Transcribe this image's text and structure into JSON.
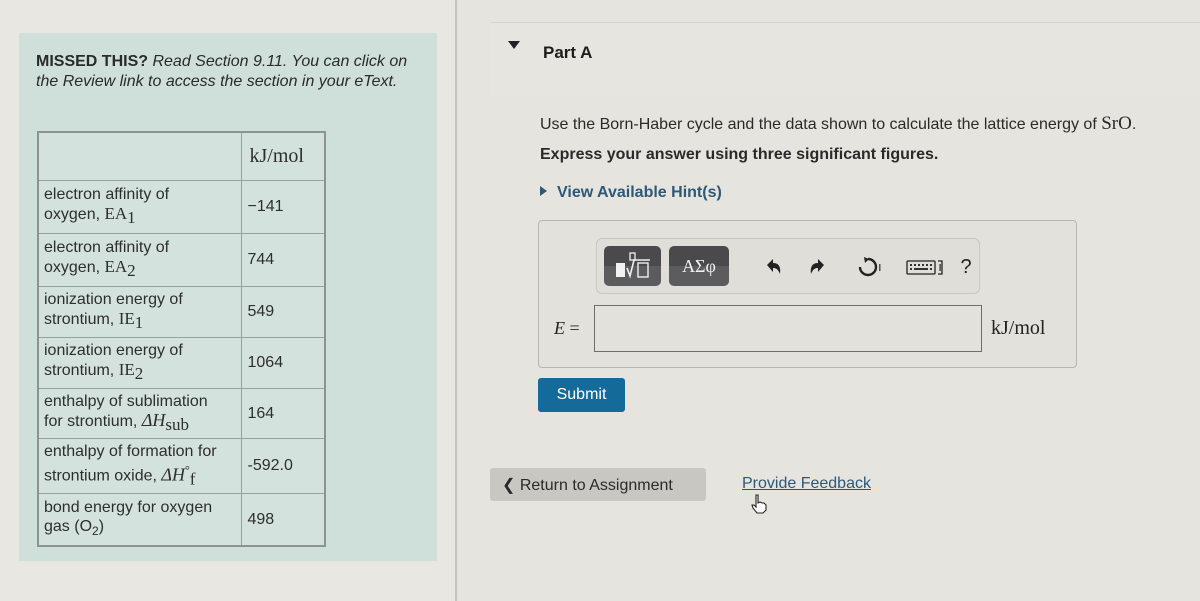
{
  "missed": {
    "prefix": "MISSED THIS?",
    "text": " Read Section 9.11. You can click on the Review link to access the section in your eText."
  },
  "table": {
    "header_unit": "kJ/mol",
    "rows": [
      {
        "label_line1": "electron affinity of",
        "label_text": "oxygen, ",
        "symbol": "EA",
        "sub": "1",
        "value": "−141"
      },
      {
        "label_line1": "electron affinity of",
        "label_text": "oxygen, ",
        "symbol": "EA",
        "sub": "2",
        "value": "744"
      },
      {
        "label_line1": "ionization energy of",
        "label_text": "strontium, ",
        "symbol": "IE",
        "sub": "1",
        "value": "549"
      },
      {
        "label_line1": "ionization energy of",
        "label_text": "strontium, ",
        "symbol": "IE",
        "sub": "2",
        "value": "1064"
      },
      {
        "label_line1": "enthalpy of sublimation",
        "label_text": "for strontium, ",
        "symbol": "ΔH",
        "sub": "sub",
        "value": "164"
      },
      {
        "label_line1": "enthalpy of formation for",
        "label_text": "strontium oxide, ",
        "symbol": "ΔH",
        "sub": "f",
        "sup": "°",
        "value": "-592.0"
      },
      {
        "label_line1": "bond energy for oxygen",
        "label_text": "gas (O",
        "sub": "2",
        "label_tail": ")",
        "value": "498"
      }
    ]
  },
  "part": {
    "title": "Part A",
    "question_prefix": "Use the Born-Haber cycle and the data shown to calculate the lattice energy of ",
    "question_formula": "SrO",
    "question_suffix": ".",
    "instruction": "Express your answer using three significant figures.",
    "hint_label": "View Available Hint(s)"
  },
  "toolbar": {
    "templates_icon": "■√□",
    "greek_label": "ΑΣφ",
    "undo_icon": "↶",
    "redo_icon": "↷",
    "reset_icon": "↻",
    "keyboard_icon": "⌨",
    "help_icon": "?"
  },
  "answer": {
    "variable": "E",
    "equals": " =",
    "value": "",
    "placeholder": "",
    "unit": "kJ/mol"
  },
  "buttons": {
    "submit": "Submit",
    "return": "❮ Return to Assignment",
    "feedback": "Provide Feedback"
  }
}
